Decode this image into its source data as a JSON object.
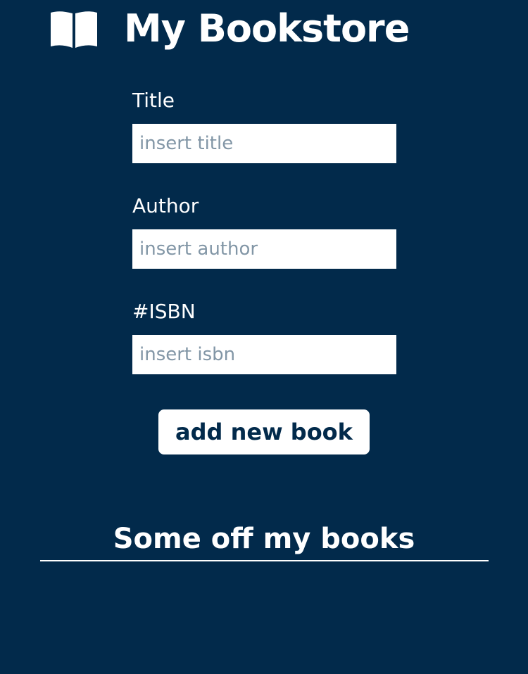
{
  "header": {
    "icon": "open-book-icon",
    "title": "My Bookstore"
  },
  "form": {
    "title_label": "Title",
    "title_placeholder": "insert title",
    "title_value": "",
    "author_label": "Author",
    "author_placeholder": "insert author",
    "author_value": "",
    "isbn_label": "#ISBN",
    "isbn_placeholder": "insert isbn",
    "isbn_value": "",
    "submit_label": "add new book"
  },
  "books": {
    "heading": "Some off my books",
    "items": []
  },
  "colors": {
    "background": "#022a4b",
    "text": "#ffffff",
    "input_background": "#ffffff",
    "placeholder": "#8296a6",
    "button_text": "#022a4b"
  }
}
